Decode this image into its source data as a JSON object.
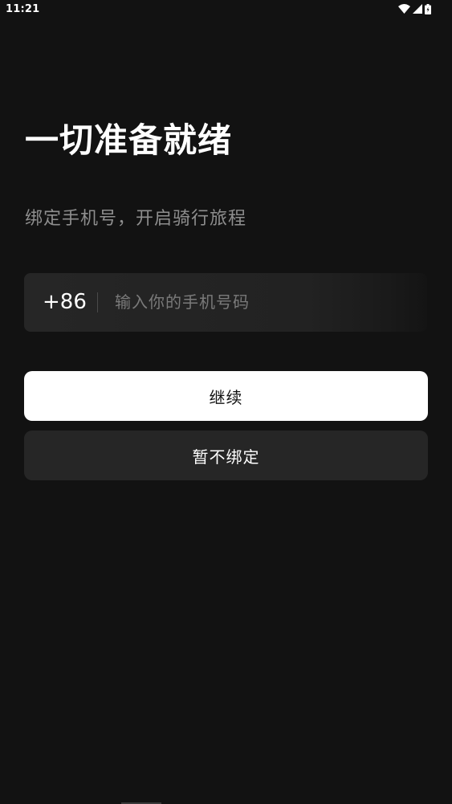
{
  "status_bar": {
    "time": "11:21",
    "icons": [
      "wifi-icon",
      "cell-signal-icon",
      "battery-icon"
    ]
  },
  "page": {
    "title": "一切准备就绪",
    "subtitle": "绑定手机号，开启骑行旅程"
  },
  "phone": {
    "country_code": "+86",
    "value": "",
    "placeholder": "输入你的手机号码"
  },
  "buttons": {
    "continue_label": "继续",
    "skip_label": "暂不绑定"
  },
  "colors": {
    "background": "#121212",
    "primary_button": "#ffffff",
    "secondary_button": "#262626",
    "subtitle_text": "#8e8e8e"
  }
}
